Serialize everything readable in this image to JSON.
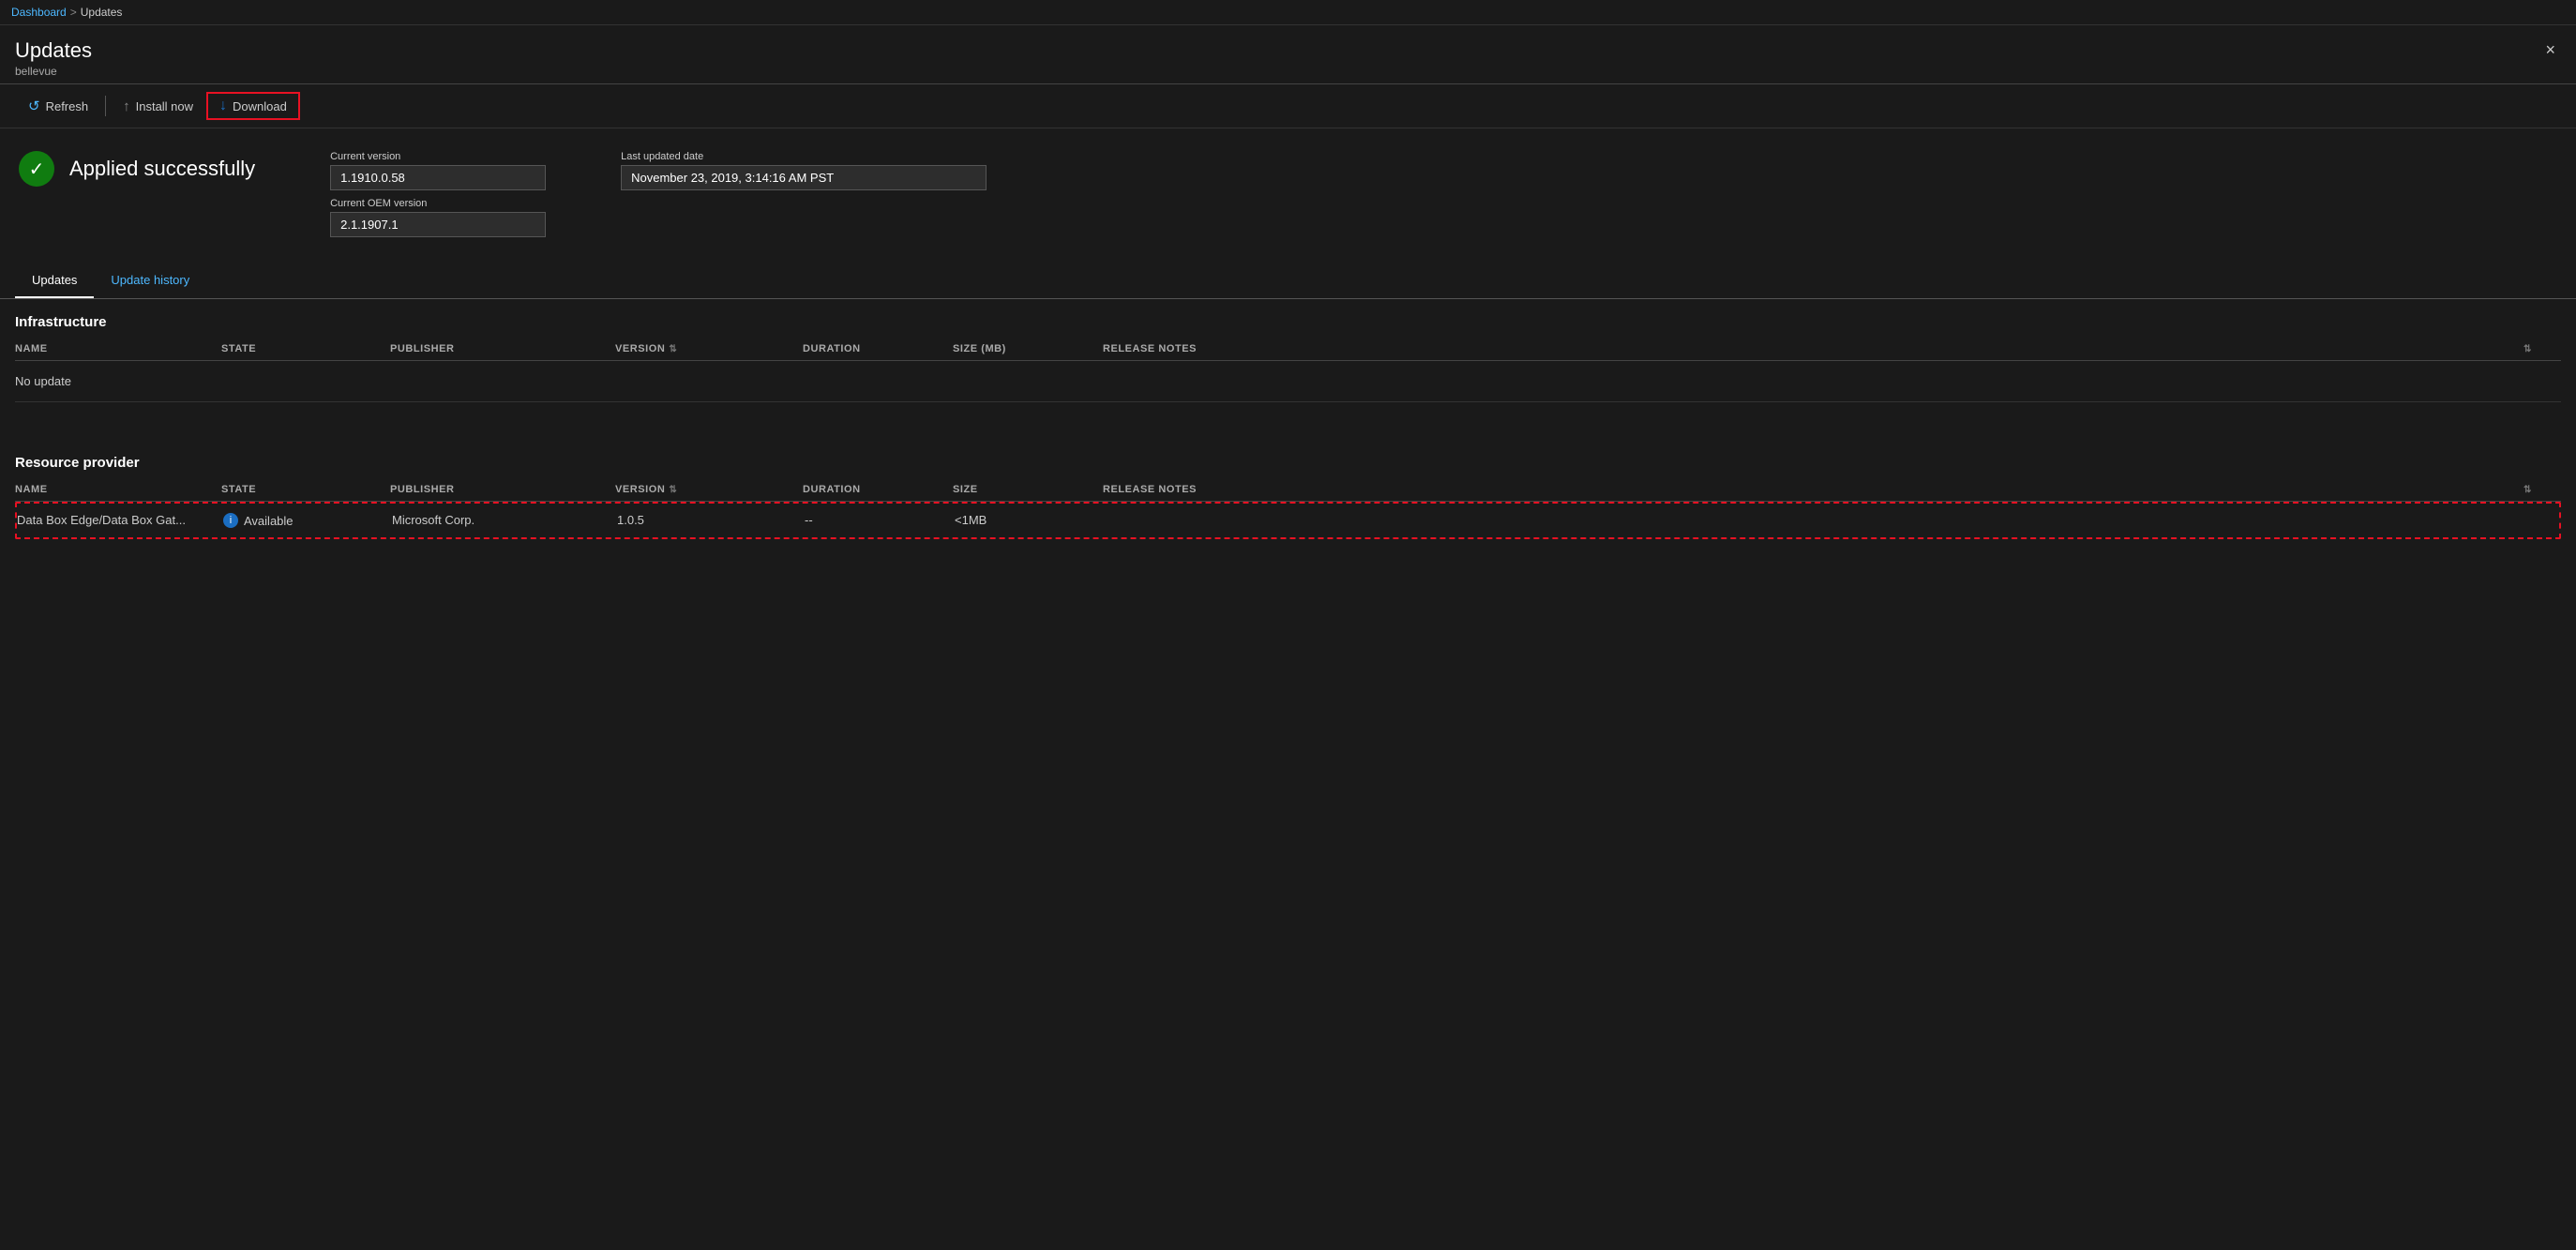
{
  "breadcrumb": {
    "parent_label": "Dashboard",
    "separator": ">",
    "current_label": "Updates"
  },
  "panel": {
    "title": "Updates",
    "subtitle": "bellevue",
    "close_label": "×"
  },
  "toolbar": {
    "refresh_label": "Refresh",
    "install_label": "Install now",
    "download_label": "Download"
  },
  "status": {
    "text": "Applied successfully",
    "current_version_label": "Current version",
    "current_version_value": "1.1910.0.58",
    "current_oem_label": "Current OEM version",
    "current_oem_value": "2.1.1907.1",
    "last_updated_label": "Last updated date",
    "last_updated_value": "November 23, 2019, 3:14:16 AM PST"
  },
  "tabs": [
    {
      "label": "Updates",
      "active": true
    },
    {
      "label": "Update history",
      "active": false
    }
  ],
  "infrastructure": {
    "heading": "Infrastructure",
    "columns": [
      {
        "label": "NAME",
        "sortable": false
      },
      {
        "label": "STATE",
        "sortable": false
      },
      {
        "label": "PUBLISHER",
        "sortable": false
      },
      {
        "label": "VERSION",
        "sortable": true
      },
      {
        "label": "DURATION",
        "sortable": false
      },
      {
        "label": "SIZE (MB)",
        "sortable": false
      },
      {
        "label": "RELEASE NOTES",
        "sortable": false
      }
    ],
    "no_update_text": "No update"
  },
  "resource_provider": {
    "heading": "Resource provider",
    "columns": [
      {
        "label": "NAME",
        "sortable": false
      },
      {
        "label": "STATE",
        "sortable": false
      },
      {
        "label": "PUBLISHER",
        "sortable": false
      },
      {
        "label": "VERSION",
        "sortable": true
      },
      {
        "label": "DURATION",
        "sortable": false
      },
      {
        "label": "SIZE",
        "sortable": false
      },
      {
        "label": "RELEASE NOTES",
        "sortable": false
      }
    ],
    "row": {
      "name": "Data Box Edge/Data Box Gat...",
      "state": "Available",
      "publisher": "Microsoft Corp.",
      "version": "1.0.5",
      "duration": "--",
      "size": "<1MB",
      "release_notes": ""
    }
  }
}
